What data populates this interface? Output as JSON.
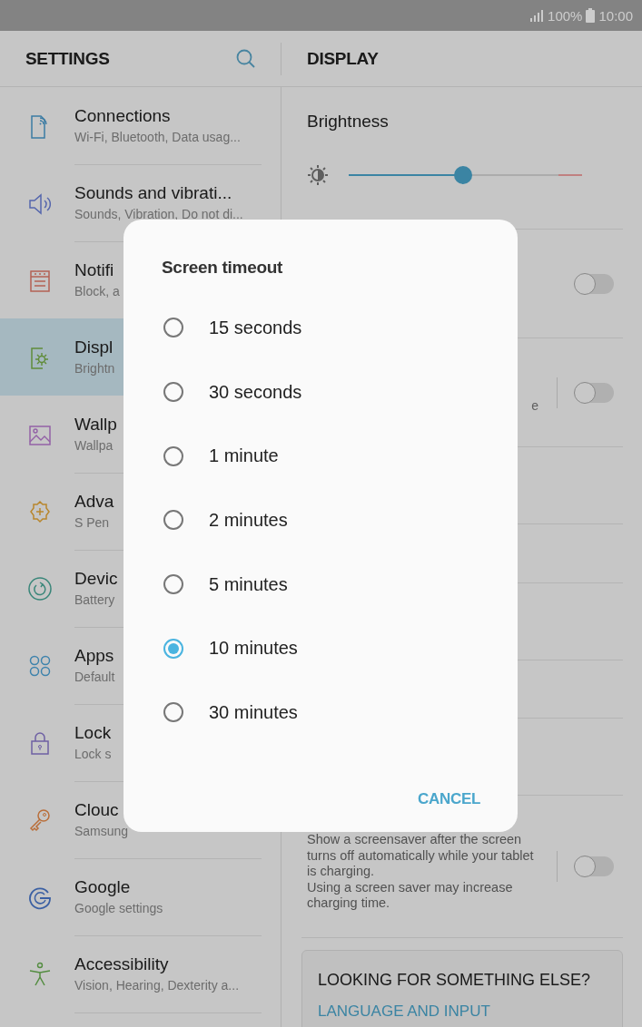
{
  "status_bar": {
    "battery": "100%",
    "time": "10:00"
  },
  "header": {
    "title": "SETTINGS",
    "pane_title": "DISPLAY"
  },
  "sidebar": {
    "items": [
      {
        "title": "Connections",
        "subtitle": "Wi-Fi, Bluetooth, Data usag...",
        "selected": false
      },
      {
        "title": "Sounds and vibrati...",
        "subtitle": "Sounds, Vibration, Do not di...",
        "selected": false
      },
      {
        "title": "Notifi",
        "subtitle": "Block, a",
        "selected": false
      },
      {
        "title": "Displ",
        "subtitle": "Brightn",
        "selected": true
      },
      {
        "title": "Wallp",
        "subtitle": "Wallpa",
        "selected": false
      },
      {
        "title": "Adva",
        "subtitle": "S Pen",
        "selected": false
      },
      {
        "title": "Devic",
        "subtitle": "Battery",
        "selected": false
      },
      {
        "title": "Apps",
        "subtitle": "Default",
        "selected": false
      },
      {
        "title": "Lock",
        "subtitle": "Lock s",
        "selected": false
      },
      {
        "title": "Clouc",
        "subtitle": "Samsung",
        "selected": false
      },
      {
        "title": "Google",
        "subtitle": "Google settings",
        "selected": false
      },
      {
        "title": "Accessibility",
        "subtitle": "Vision, Hearing, Dexterity a...",
        "selected": false
      }
    ]
  },
  "display": {
    "brightness": {
      "label": "Brightness",
      "level": 0.49
    },
    "rows": [
      {
        "kind": "toggle",
        "on": false
      },
      {
        "kind": "toggle",
        "on": false,
        "fragment": "e"
      },
      {
        "kind": "blank"
      },
      {
        "kind": "blank"
      },
      {
        "kind": "blank"
      },
      {
        "kind": "blank"
      },
      {
        "kind": "blank"
      },
      {
        "kind": "toggle",
        "on": false,
        "description": [
          "Show a screensaver after the screen turns off automatically while your tablet is charging.",
          "Using a screen saver may increase charging time."
        ]
      }
    ],
    "suggestion": {
      "title": "LOOKING FOR SOMETHING ELSE?",
      "link": "LANGUAGE AND INPUT"
    }
  },
  "dialog": {
    "title": "Screen timeout",
    "options": [
      {
        "label": "15 seconds",
        "selected": false
      },
      {
        "label": "30 seconds",
        "selected": false
      },
      {
        "label": "1 minute",
        "selected": false
      },
      {
        "label": "2 minutes",
        "selected": false
      },
      {
        "label": "5 minutes",
        "selected": false
      },
      {
        "label": "10 minutes",
        "selected": true
      },
      {
        "label": "30 minutes",
        "selected": false
      }
    ],
    "button": "CANCEL"
  }
}
